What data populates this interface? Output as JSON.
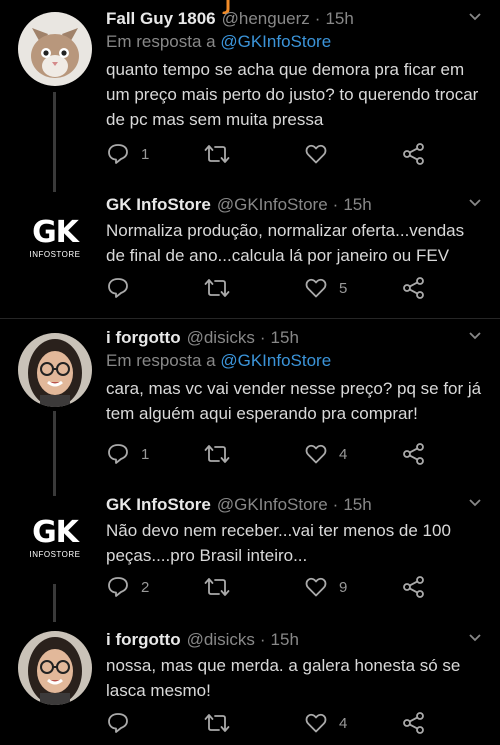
{
  "tweets": [
    {
      "name": "Fall Guy 1806",
      "handle": "@henguerz",
      "time": "15h",
      "reply_prefix": "Em resposta a",
      "reply_handle": "@GKInfoStore",
      "text": "quanto tempo se acha que demora pra ficar em um preço mais perto do justo? to querendo trocar de pc mas sem muita pressa",
      "replies": "1",
      "retweets": "",
      "likes": "",
      "avatar": "cat-avatar"
    },
    {
      "name": "GK InfoStore",
      "handle": "@GKInfoStore",
      "time": "15h",
      "text": "Normaliza produção, normalizar oferta...vendas de final de ano...calcula lá por janeiro ou FEV",
      "replies": "",
      "retweets": "",
      "likes": "5",
      "avatar": "gk-logo"
    },
    {
      "name": "i forgotto",
      "handle": "@disicks",
      "time": "15h",
      "reply_prefix": "Em resposta a",
      "reply_handle": "@GKInfoStore",
      "text": "cara, mas vc vai vender nesse preço? pq se for já tem alguém aqui esperando pra comprar!",
      "replies": "1",
      "retweets": "",
      "likes": "4",
      "avatar": "person-avatar"
    },
    {
      "name": "GK InfoStore",
      "handle": "@GKInfoStore",
      "time": "15h",
      "text": "Não devo nem receber...vai ter menos de 100 peças....pro Brasil inteiro...",
      "replies": "2",
      "retweets": "",
      "likes": "9",
      "avatar": "gk-logo"
    },
    {
      "name": "i forgotto",
      "handle": "@disicks",
      "time": "15h",
      "text": "nossa, mas que merda. a galera honesta só se lasca mesmo!",
      "replies": "",
      "retweets": "",
      "likes": "4",
      "avatar": "person-avatar"
    }
  ],
  "gk_logo": {
    "mark": "GK",
    "sub": "INFOSTORE"
  },
  "colors": {
    "background": "#000000",
    "link": "#3b94d9",
    "muted": "#888888",
    "accent": "#f28c28"
  }
}
